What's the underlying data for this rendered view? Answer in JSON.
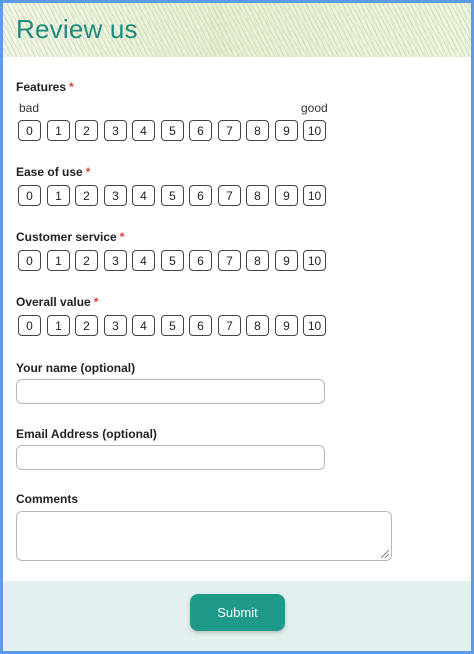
{
  "form": {
    "title": "Review us",
    "accent_color": "#1f8a80",
    "required_color": "#e23c3c",
    "required_marker": "*"
  },
  "scale": {
    "low_label": "bad",
    "high_label": "good",
    "values": [
      "0",
      "1",
      "2",
      "3",
      "4",
      "5",
      "6",
      "7",
      "8",
      "9",
      "10"
    ]
  },
  "questions": {
    "features": {
      "label": "Features"
    },
    "ease_of_use": {
      "label": "Ease of use"
    },
    "customer_service": {
      "label": "Customer service"
    },
    "overall_value": {
      "label": "Overall value"
    }
  },
  "fields": {
    "name": {
      "label": "Your name (optional)",
      "value": "",
      "placeholder": ""
    },
    "email": {
      "label": "Email Address (optional)",
      "value": "",
      "placeholder": ""
    },
    "comments": {
      "label": "Comments",
      "value": ""
    }
  },
  "footer": {
    "submit_label": "Submit",
    "button_color": "#1f9a8a"
  }
}
